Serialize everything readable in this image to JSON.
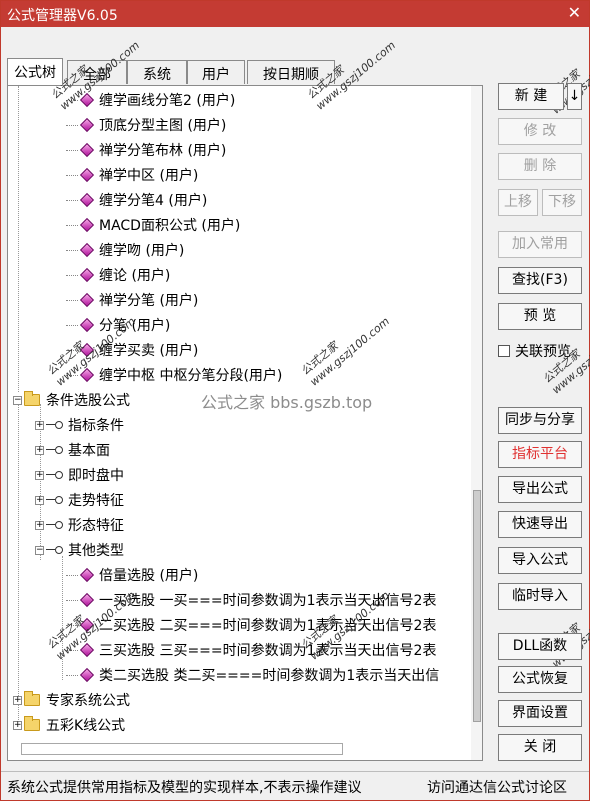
{
  "window": {
    "title": "公式管理器V6.05",
    "close_glyph": "✕"
  },
  "tabs": [
    {
      "label": "公式树"
    },
    {
      "label": "全部"
    },
    {
      "label": "系统"
    },
    {
      "label": "用户"
    },
    {
      "label": "按日期顺"
    }
  ],
  "tree": {
    "rows": [
      {
        "text": "缠学画线分笔2  (用户)"
      },
      {
        "text": "顶底分型主图  (用户)"
      },
      {
        "text": "禅学分笔布林  (用户)"
      },
      {
        "text": "禅学中区  (用户)"
      },
      {
        "text": "缠学分笔4  (用户)"
      },
      {
        "text": "MACD面积公式  (用户)"
      },
      {
        "text": "缠学吻  (用户)"
      },
      {
        "text": "缠论  (用户)"
      },
      {
        "text": "禅学分笔  (用户)"
      },
      {
        "text": "分笔  (用户)"
      },
      {
        "text": "缠学买卖  (用户)"
      },
      {
        "text": "缠学中枢  中枢分笔分段(用户)"
      },
      {
        "text": "条件选股公式"
      },
      {
        "text": "指标条件"
      },
      {
        "text": "基本面"
      },
      {
        "text": "即时盘中"
      },
      {
        "text": "走势特征"
      },
      {
        "text": "形态特征"
      },
      {
        "text": "其他类型"
      },
      {
        "text": "倍量选股  (用户)"
      },
      {
        "text": "一买选股  一买===时间参数调为1表示当天出信号2表"
      },
      {
        "text": "二买选股  二买===时间参数调为1表示当天出信号2表"
      },
      {
        "text": "三买选股  三买===时间参数调为1表示当天出信号2表"
      },
      {
        "text": "类二买选股  类二买====时间参数调为1表示当天出信"
      },
      {
        "text": "专家系统公式"
      },
      {
        "text": "五彩K线公式"
      }
    ]
  },
  "buttons": {
    "new": "新  建",
    "new_arrow": "↓",
    "modify": "修  改",
    "delete": "删  除",
    "move_up": "上移",
    "move_down": "下移",
    "add_common": "加入常用",
    "find": "查找(F3)",
    "preview": "预  览",
    "sync_share": "同步与分享",
    "indicator_platform": "指标平台",
    "export": "导出公式",
    "quick_export": "快速导出",
    "import": "导入公式",
    "temp_import": "临时导入",
    "dll": "DLL函数",
    "restore": "公式恢复",
    "ui_settings": "界面设置",
    "close": "关  闭"
  },
  "link_checkbox": {
    "label": "关联预览",
    "checked": false
  },
  "watermark": {
    "text": "公式之家 bbs.gszb.top",
    "stamp": "公式之家",
    "stamp_url": "www.gszj100.com"
  },
  "status": {
    "left": "系统公式提供常用指标及模型的实现样本,不表示操作建议",
    "right": "访问通达信公式讨论区"
  },
  "colors": {
    "title_bar": "#c43b33",
    "accent_red": "#e03030"
  }
}
